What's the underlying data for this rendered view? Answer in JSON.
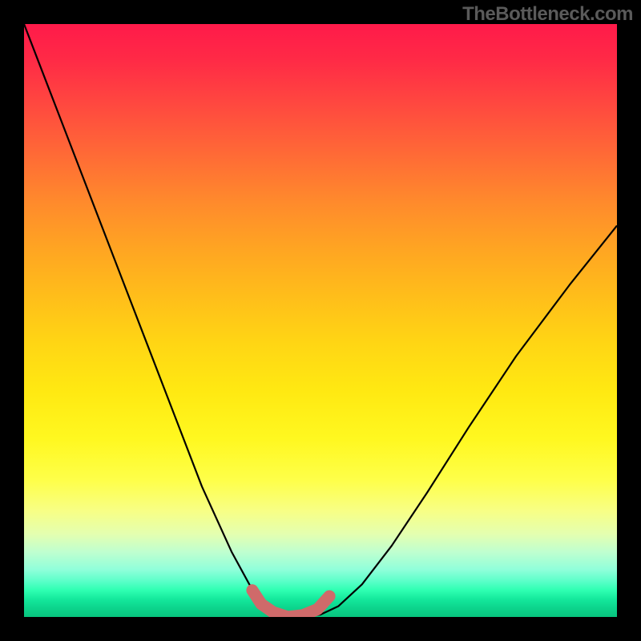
{
  "watermark": "TheBottleneck.com",
  "colors": {
    "curve": "#000000",
    "trough_marker": "#cf6a6a",
    "frame_bg": "#000000"
  },
  "chart_data": {
    "type": "line",
    "title": "",
    "xlabel": "",
    "ylabel": "",
    "xlim": [
      0,
      1
    ],
    "ylim": [
      0,
      1
    ],
    "description": "V-shaped bottleneck curve over vertical rainbow gradient (red=high bottleneck at top, green=low at bottom). Curve falls steeply from top-left, reaches a flat trough near x≈0.42–0.50 at the bottom edge, then rises more gradually toward the upper right.",
    "series": [
      {
        "name": "bottleneck-curve",
        "x": [
          0.0,
          0.05,
          0.1,
          0.15,
          0.2,
          0.25,
          0.3,
          0.35,
          0.38,
          0.41,
          0.44,
          0.47,
          0.5,
          0.53,
          0.57,
          0.62,
          0.68,
          0.75,
          0.83,
          0.92,
          1.0
        ],
        "y": [
          1.0,
          0.87,
          0.74,
          0.61,
          0.48,
          0.35,
          0.22,
          0.11,
          0.055,
          0.02,
          0.005,
          0.0,
          0.004,
          0.018,
          0.055,
          0.12,
          0.21,
          0.32,
          0.44,
          0.56,
          0.66
        ]
      }
    ],
    "trough_marker": {
      "comment": "Thick salmon highlight along the flat minimum of the curve",
      "x": [
        0.385,
        0.4,
        0.42,
        0.445,
        0.47,
        0.495,
        0.515
      ],
      "y": [
        0.045,
        0.022,
        0.008,
        0.0,
        0.003,
        0.013,
        0.035
      ]
    }
  }
}
